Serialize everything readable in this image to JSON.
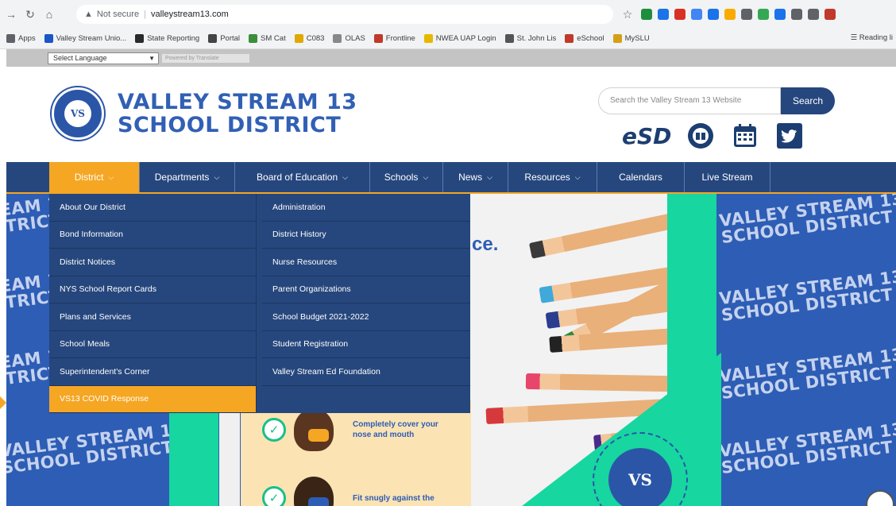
{
  "browser": {
    "security_label": "Not secure",
    "url": "valleystream13.com",
    "bookmarks": [
      {
        "label": "Apps",
        "color": "#5f6368"
      },
      {
        "label": "Valley Stream Unio...",
        "color": "#1a56c4"
      },
      {
        "label": "State Reporting",
        "color": "#2a2a2a"
      },
      {
        "label": "Portal",
        "color": "#444"
      },
      {
        "label": "SM Cat",
        "color": "#3a8f3a"
      },
      {
        "label": "C083",
        "color": "#e0a800"
      },
      {
        "label": "OLAS",
        "color": "#888"
      },
      {
        "label": "Frontline",
        "color": "#c0392b"
      },
      {
        "label": "NWEA UAP Login",
        "color": "#e6b800"
      },
      {
        "label": "St. John Lis",
        "color": "#555"
      },
      {
        "label": "eSchool",
        "color": "#c0392b"
      },
      {
        "label": "MySLU",
        "color": "#d4a017"
      }
    ],
    "reading_list": "Reading li",
    "extension_colors": [
      "#1e8e3e",
      "#1a73e8",
      "#d93025",
      "#4285f4",
      "#1a73e8",
      "#f9ab00",
      "#5f6368",
      "#34a853",
      "#1a73e8",
      "#5f6368",
      "#5f6368",
      "#c0392b"
    ]
  },
  "translate": {
    "select_label": "Select Language",
    "powered_by": "Powered by Translate"
  },
  "site": {
    "seal_text": "VS",
    "name_line1": "VALLEY STREAM 13",
    "name_line2": "SCHOOL DISTRICT",
    "search_placeholder": "Search the Valley Stream 13 Website",
    "search_button": "Search",
    "esd_label": "eSD",
    "brand_blue": "#26477d",
    "accent_orange": "#f5a623",
    "accent_green": "#17d6a0"
  },
  "nav": {
    "items": [
      {
        "label": "District",
        "chevron": true
      },
      {
        "label": "Departments",
        "chevron": true
      },
      {
        "label": "Board of Education",
        "chevron": true
      },
      {
        "label": "Schools",
        "chevron": true
      },
      {
        "label": "News",
        "chevron": true
      },
      {
        "label": "Resources",
        "chevron": true
      },
      {
        "label": "Calendars",
        "chevron": false
      },
      {
        "label": "Live Stream",
        "chevron": false
      }
    ]
  },
  "dropdown": {
    "left": [
      "About Our District",
      "Bond Information",
      "District Notices",
      "NYS School Report Cards",
      "Plans and Services",
      "School Meals",
      "Superintendent's Corner",
      "VS13 COVID Response"
    ],
    "right": [
      "Administration",
      "District History",
      "Nurse Resources",
      "Parent Organizations",
      "School Budget 2021-2022",
      "Student Registration",
      "Valley Stream Ed Foundation"
    ]
  },
  "hero": {
    "pattern_line1": "VALLEY STREAM 13",
    "pattern_line2": "SCHOOL DISTRICT",
    "headline_fragment": "ce.",
    "mask_caption_1": "Completely cover your nose and mouth",
    "mask_caption_2": "Fit snugly against the",
    "bottom_seal_text": "VS"
  }
}
